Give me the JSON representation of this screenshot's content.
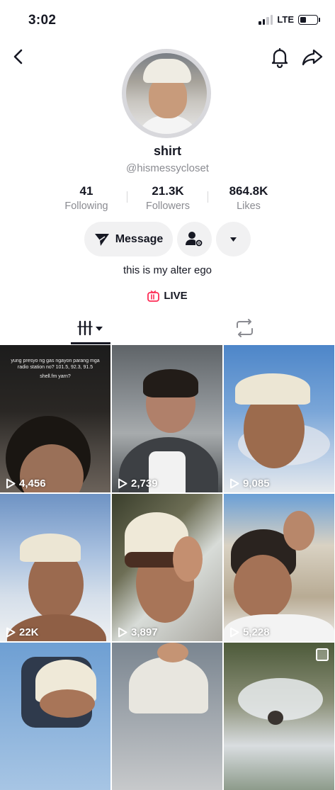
{
  "status_bar": {
    "time": "3:02",
    "network": "LTE"
  },
  "profile": {
    "name": "shirt",
    "handle": "@hismessycloset",
    "bio": "this is my alter ego",
    "live_label": "LIVE"
  },
  "stats": {
    "following": {
      "value": "41",
      "label": "Following"
    },
    "followers": {
      "value": "21.3K",
      "label": "Followers"
    },
    "likes": {
      "value": "864.8K",
      "label": "Likes"
    }
  },
  "actions": {
    "message_label": "Message"
  },
  "videos": [
    {
      "views": "4,456",
      "caption_line1": "yung presyo ng gas ngayon parang mga radio station no? 101.5, 92.3, 91.5",
      "caption_line2": "shell.fm yarn?"
    },
    {
      "views": "2,739"
    },
    {
      "views": "9,085"
    },
    {
      "views": "22K"
    },
    {
      "views": "3,897"
    },
    {
      "views": "5,228"
    },
    {
      "views": ""
    },
    {
      "views": ""
    },
    {
      "views": ""
    }
  ],
  "colors": {
    "live_accent": "#fe2c55",
    "tab_active": "#161823",
    "muted_text": "#8a8b91"
  },
  "icons": [
    "back-icon",
    "bell-icon",
    "share-icon",
    "send-icon",
    "add-friend-icon",
    "chevron-down-icon",
    "live-icon",
    "grid-icon",
    "repost-icon",
    "play-icon"
  ]
}
